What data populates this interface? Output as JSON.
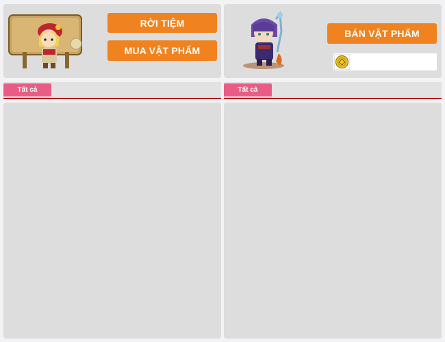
{
  "left": {
    "leave_label": "RỜI TIỆM",
    "buy_label": "MUA VẬT PHẨM",
    "tab_all": "Tất cả",
    "avatar_icon": "shopkeeper-with-sign-icon"
  },
  "right": {
    "sell_label": "BÁN VẬT PHẨM",
    "tab_all": "Tất cả",
    "avatar_icon": "player-character-icon",
    "currency_icon": "gold-coin-icon",
    "currency_value": ""
  },
  "colors": {
    "button": "#f0831f",
    "tab": "#e85c86",
    "tab_underline": "#b8101c",
    "panel": "#dddddd",
    "background": "#f3f3f5"
  }
}
